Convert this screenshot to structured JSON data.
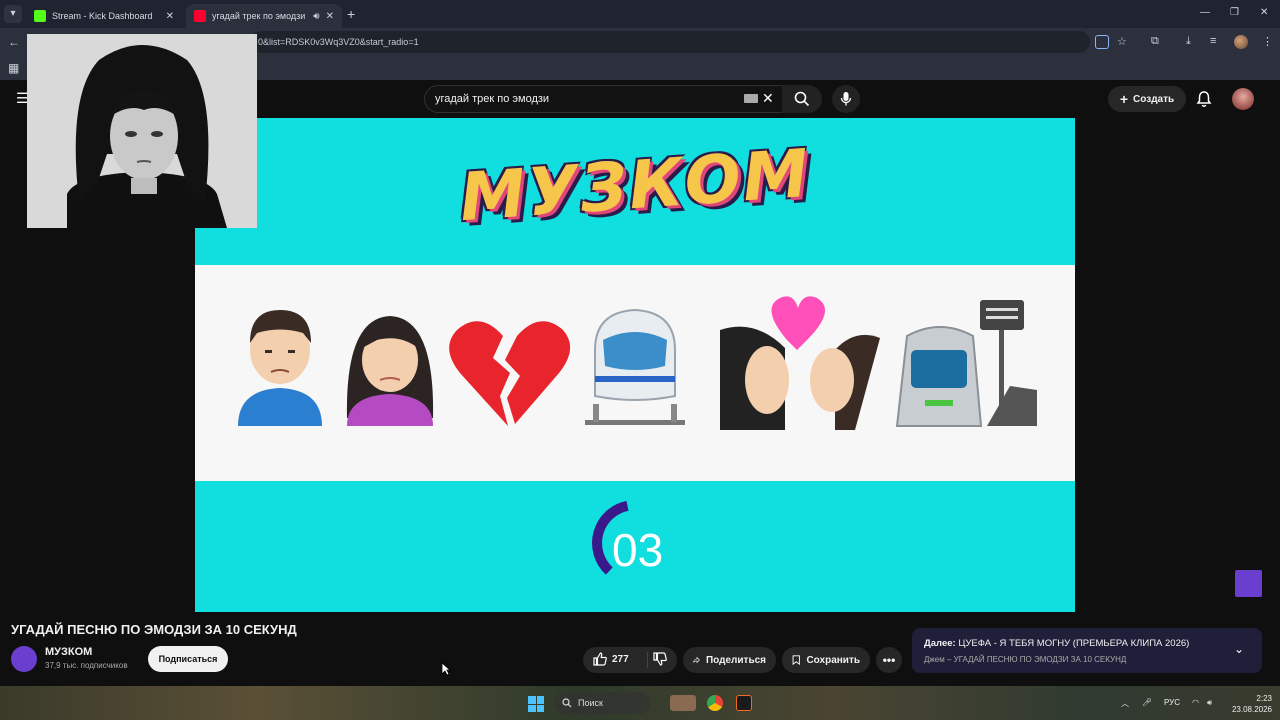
{
  "browser": {
    "tabs": [
      {
        "title": "Stream - Kick Dashboard",
        "favicon_color": "#53fc18"
      },
      {
        "title": "угадай трек по эмодзи - YouTube",
        "favicon_color": "#ff0033"
      }
    ],
    "url_fragment": "0&list=RDSK0v3Wq3VZ0&start_radio=1"
  },
  "youtube": {
    "search": {
      "query": "угадай трек по эмодзи"
    },
    "create_label": "Создать"
  },
  "video": {
    "brand_logo_text": "МУЗКОМ",
    "emojis": [
      "man",
      "woman",
      "broken-heart",
      "train",
      "kiss",
      "train-station"
    ],
    "timer_value": "03",
    "timer_progress": 0.35
  },
  "watch": {
    "title": "УГАДАЙ ПЕСНЮ ПО ЭМОДЗИ ЗА 10 СЕКУНД",
    "channel": {
      "name": "МУЗКОМ",
      "subscribers": "37,9 тыс. подписчиков"
    },
    "subscribe_label": "Подписаться",
    "likes": "277",
    "share_label": "Поделиться",
    "save_label": "Сохранить",
    "next_up": {
      "prefix": "Далее:",
      "title": "ЦУЕФА - Я ТЕБЯ МОГНУ (ПРЕМЬЕРА КЛИПА 2026)",
      "subtitle": "Джем – УГАДАЙ ПЕСНЮ ПО ЭМОДЗИ ЗА 10 СЕКУНД"
    }
  },
  "taskbar": {
    "search_label": "Поиск",
    "language": "РУС",
    "time": "2:23",
    "date": "23.08.2026"
  },
  "colors": {
    "video_bg": "#11dede",
    "accent_purple": "#6a3fd0",
    "timer_arc": "#3a1a8a"
  }
}
